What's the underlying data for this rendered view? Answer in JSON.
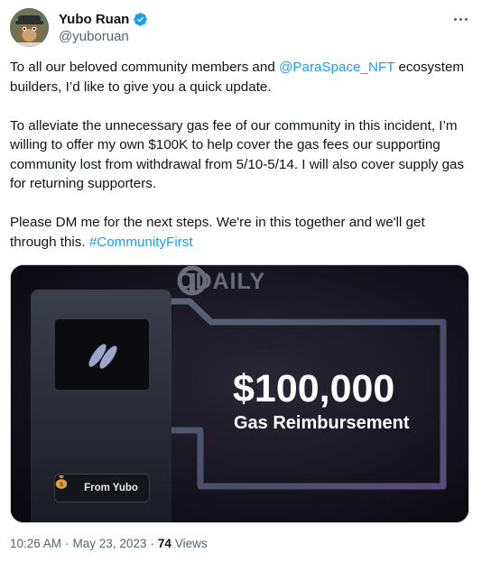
{
  "author": {
    "display_name": "Yubo Ruan",
    "handle": "@yuboruan",
    "avatar_icon": "ape-avatar-icon",
    "verified_icon": "verified-badge-icon",
    "verified_color": "#1d9bf0"
  },
  "more_icon": "more-options-icon",
  "tweet": {
    "p1_text": "To all our beloved community members and ",
    "p1_mention": "@ParaSpace_NFT",
    "p1_rest": " ecosystem builders, I’d like to give you a quick update.",
    "p2_text": "To alleviate the unnecessary gas fee of our community in this incident, I’m willing to offer my own $100K to help cover the gas fees our supporting community lost from withdrawal from 5/10-5/14. I will also cover supply gas for returning supporters.",
    "p3_text": "Please DM me for the next steps. We're in this together and we'll get through this. ",
    "p3_hashtag": "#CommunityFirst",
    "link_color": "#1d9bf0"
  },
  "media": {
    "watermark": "ODAILY",
    "amount": "$100,000",
    "subtitle": "Gas Reimbursement",
    "badge_label": "From Yubo",
    "badge_icon": "money-bag-icon",
    "logo_icon": "paraspace-logo-icon"
  },
  "meta": {
    "time": "10:26 AM",
    "sep1": "·",
    "date": "May 23, 2023",
    "sep2": "·",
    "views_count": "74",
    "views_label": "Views"
  }
}
